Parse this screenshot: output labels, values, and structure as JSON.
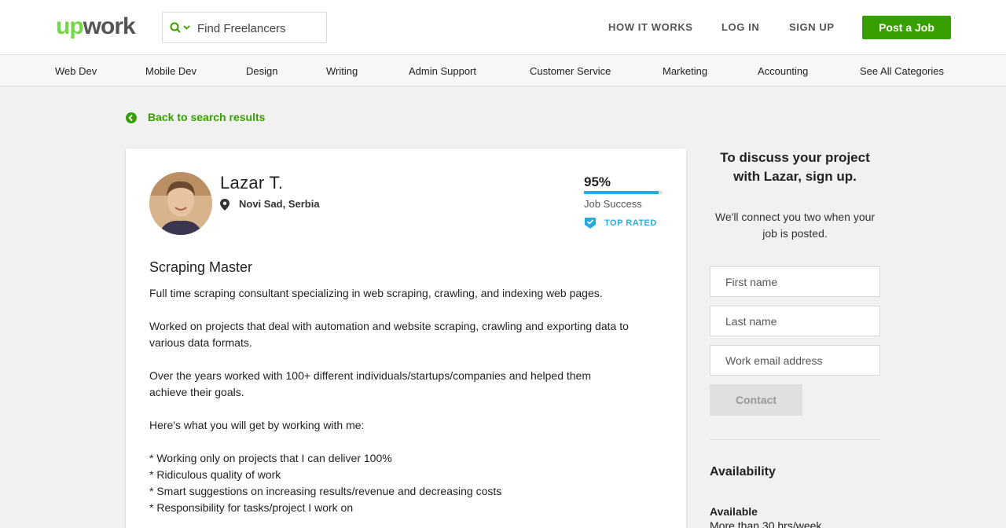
{
  "header": {
    "logo_up": "up",
    "logo_work": "work",
    "search_placeholder": "Find Freelancers",
    "links": [
      "HOW IT WORKS",
      "LOG IN",
      "SIGN UP"
    ],
    "post_job": "Post a Job"
  },
  "categories": [
    "Web Dev",
    "Mobile Dev",
    "Design",
    "Writing",
    "Admin Support",
    "Customer Service",
    "Marketing",
    "Accounting",
    "See All Categories"
  ],
  "back_link": "Back to search results",
  "profile": {
    "name": "Lazar T.",
    "location": "Novi Sad, Serbia",
    "job_success_pct": "95%",
    "job_success_value": 0.95,
    "job_success_label": "Job Success",
    "badge": "TOP RATED",
    "title": "Scraping Master",
    "desc": {
      "p1": "Full time scraping consultant specializing in web scraping, crawling, and indexing web pages.",
      "p2": "Worked on projects that deal with automation and website scraping, crawling and exporting data to various data formats.",
      "p3": "Over the years worked with 100+ different individuals/startups/companies and helped them achieve their goals.",
      "p4": "Here's what you will get by working with me:",
      "bullets": [
        "* Working only on projects that I can deliver 100%",
        "* Ridiculous quality of work",
        "* Smart suggestions on increasing results/revenue and decreasing costs",
        "* Responsibility for tasks/project I work on"
      ]
    }
  },
  "sidebar": {
    "heading": "To discuss your project with Lazar, sign up.",
    "subtext": "We'll connect you two when your job is posted.",
    "first_name_placeholder": "First name",
    "last_name_placeholder": "Last name",
    "email_placeholder": "Work email address",
    "contact_label": "Contact",
    "availability_heading": "Availability",
    "availability_status": "Available",
    "availability_detail": "More than 30 hrs/week"
  },
  "colors": {
    "brand_green": "#37a000",
    "logo_green": "#6fda44",
    "accent_blue": "#29abe2"
  },
  "icons": [
    "search-icon",
    "chevron-down-icon",
    "back-arrow-icon",
    "location-pin-icon",
    "top-rated-badge-icon"
  ]
}
